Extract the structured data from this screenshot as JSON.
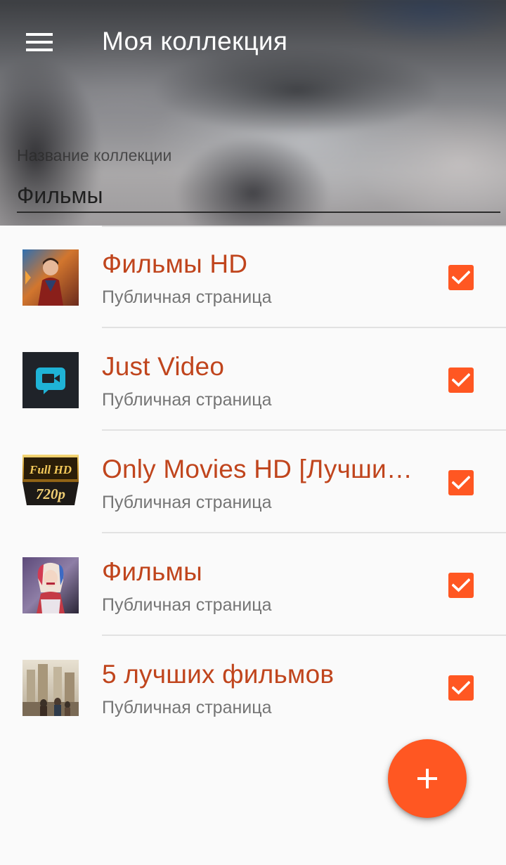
{
  "header": {
    "title": "Моя коллекция",
    "field_label": "Название коллекции",
    "field_value": "Фильмы",
    "menu_icon": "menu-icon"
  },
  "colors": {
    "accent": "#ff5722",
    "title_text": "#c0451d",
    "subtitle_text": "#757575"
  },
  "thumb_texts": {
    "fullhd_top": "Full HD",
    "fullhd_bottom": "720p"
  },
  "list": {
    "items": [
      {
        "title": "Фильмы HD",
        "subtitle": "Публичная страница",
        "checked": true,
        "thumbnail": "superhero-poster-thumbnail"
      },
      {
        "title": "Just Video",
        "subtitle": "Публичная страница",
        "checked": true,
        "thumbnail": "video-camera-logo-thumbnail"
      },
      {
        "title": "Only Movies HD [Лучшие фильмы]",
        "subtitle": "Публичная страница",
        "checked": true,
        "thumbnail": "full-hd-720p-badge-thumbnail"
      },
      {
        "title": "Фильмы",
        "subtitle": "Публичная страница",
        "checked": true,
        "thumbnail": "movie-character-thumbnail"
      },
      {
        "title": "5 лучших фильмов",
        "subtitle": "Публичная страница",
        "checked": true,
        "thumbnail": "city-scene-thumbnail"
      }
    ]
  },
  "fab": {
    "icon": "plus-icon"
  }
}
